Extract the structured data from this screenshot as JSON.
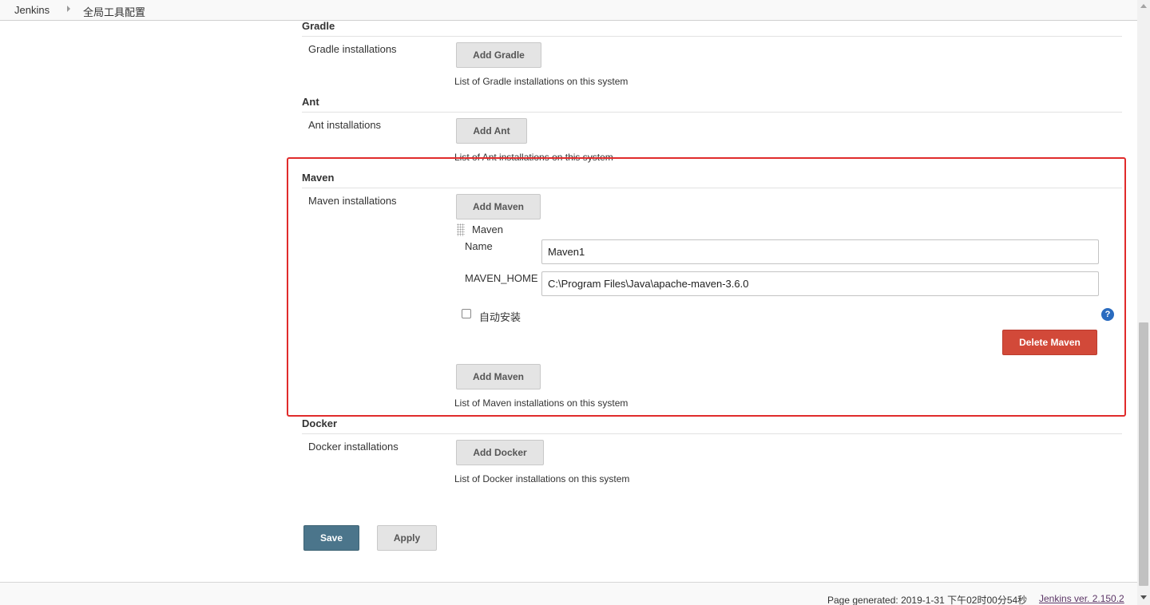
{
  "breadcrumb": {
    "items": [
      "Jenkins",
      "全局工具配置"
    ]
  },
  "sections": {
    "gradle": {
      "title": "Gradle",
      "label": "Gradle installations",
      "add_button": "Add Gradle",
      "hint": "List of Gradle installations on this system"
    },
    "ant": {
      "title": "Ant",
      "label": "Ant installations",
      "add_button": "Add Ant",
      "hint": "List of Ant installations on this system"
    },
    "maven": {
      "title": "Maven",
      "label": "Maven installations",
      "add_button_top": "Add Maven",
      "installation": {
        "heading": "Maven",
        "name_label": "Name",
        "name_value": "Maven1",
        "home_label": "MAVEN_HOME",
        "home_value": "C:\\Program Files\\Java\\apache-maven-3.6.0",
        "auto_install_label": "自动安装",
        "auto_install_checked": false,
        "delete_button": "Delete Maven",
        "help_glyph": "?"
      },
      "add_button_bottom": "Add Maven",
      "hint": "List of Maven installations on this system"
    },
    "docker": {
      "title": "Docker",
      "label": "Docker installations",
      "add_button": "Add Docker",
      "hint": "List of Docker installations on this system"
    }
  },
  "actions": {
    "save": "Save",
    "apply": "Apply"
  },
  "footer": {
    "generated": "Page generated: 2019-1-31 下午02时00分54秒",
    "version_link": "Jenkins ver. 2.150.2"
  },
  "colors": {
    "highlight_border": "#e02b2b",
    "save_button": "#4b758b",
    "delete_button": "#d24939",
    "help_icon": "#2a6bbf"
  },
  "icons": [
    "chevron-right-icon",
    "drag-handle-icon",
    "help-icon"
  ]
}
